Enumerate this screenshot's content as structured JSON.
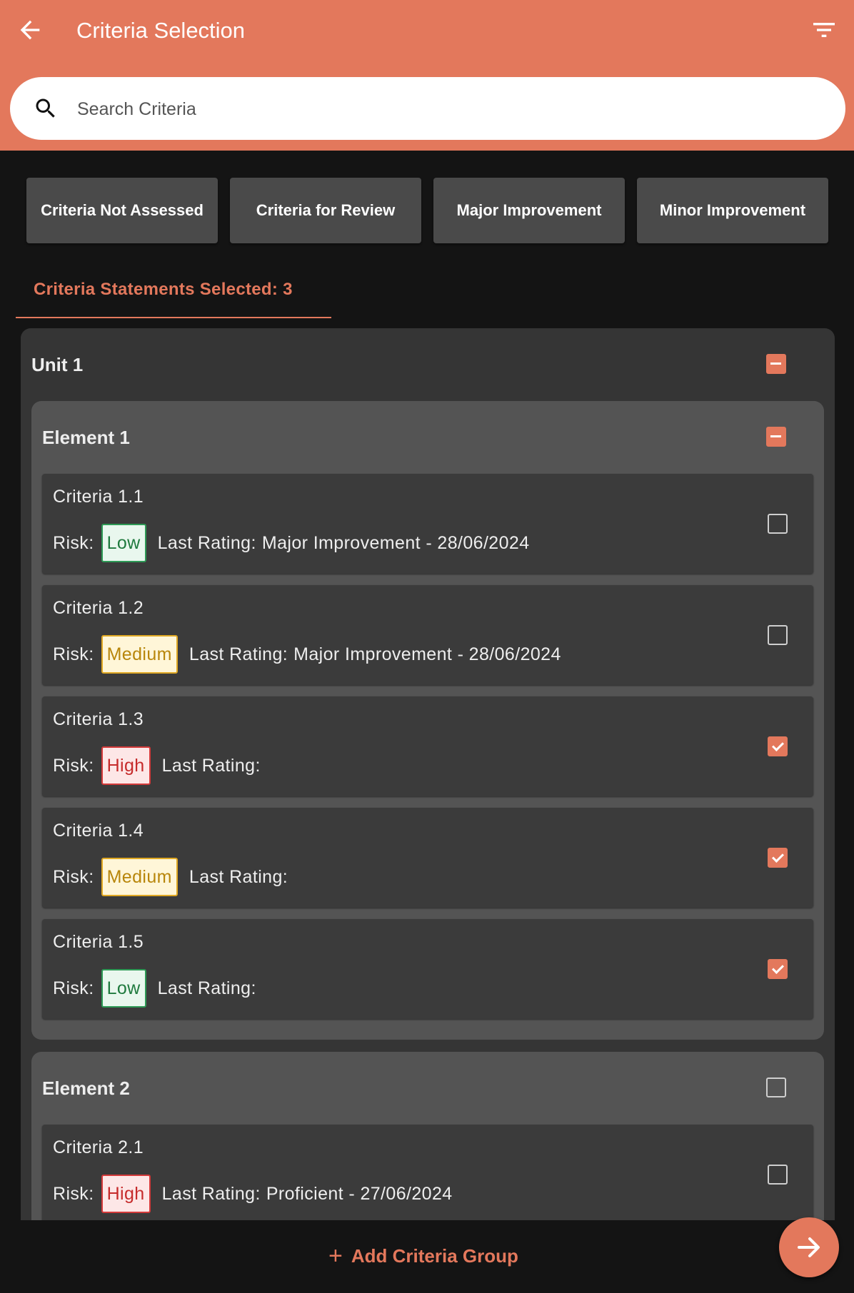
{
  "header": {
    "title": "Criteria Selection"
  },
  "search": {
    "placeholder": "Search Criteria"
  },
  "filters": [
    "Criteria Not Assessed",
    "Criteria for Review",
    "Major Improvement",
    "Minor Improvement"
  ],
  "tab": {
    "label": "Criteria Statements Selected: 3"
  },
  "labels": {
    "risk": "Risk:",
    "last_rating": "Last Rating:"
  },
  "unit": {
    "title": "Unit 1",
    "state": "partial",
    "elements": [
      {
        "title": "Element 1",
        "state": "partial",
        "criteria": [
          {
            "name": "Criteria 1.1",
            "risk": "Low",
            "last_rating": "Major Improvement - 28/06/2024",
            "checked": false
          },
          {
            "name": "Criteria 1.2",
            "risk": "Medium",
            "last_rating": "Major Improvement - 28/06/2024",
            "checked": false
          },
          {
            "name": "Criteria 1.3",
            "risk": "High",
            "last_rating": "",
            "checked": true
          },
          {
            "name": "Criteria 1.4",
            "risk": "Medium",
            "last_rating": "",
            "checked": true
          },
          {
            "name": "Criteria 1.5",
            "risk": "Low",
            "last_rating": "",
            "checked": true
          }
        ]
      },
      {
        "title": "Element 2",
        "state": "unchecked",
        "criteria": [
          {
            "name": "Criteria 2.1",
            "risk": "High",
            "last_rating": "Proficient - 27/06/2024",
            "checked": false
          }
        ]
      }
    ]
  },
  "footer": {
    "add_label": "Add Criteria Group"
  },
  "colors": {
    "accent": "#e3785c",
    "background": "#141414",
    "low": "#2e9a56",
    "medium": "#e0a823",
    "high": "#d43a3a"
  }
}
